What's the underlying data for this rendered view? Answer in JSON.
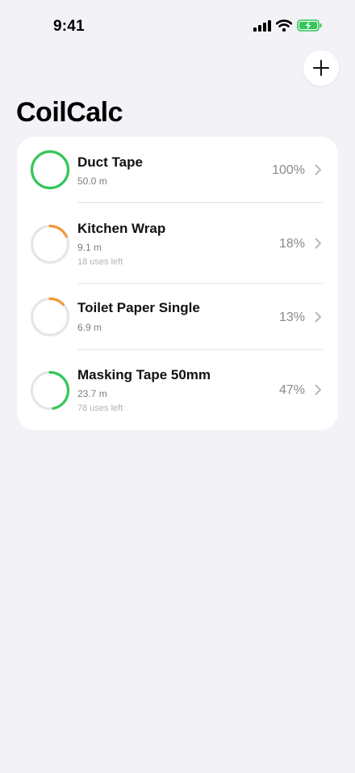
{
  "status_bar": {
    "time": "9:41"
  },
  "header": {
    "title": "CoilCalc",
    "add_icon": "plus-icon"
  },
  "colors": {
    "full": "#34c759",
    "low": "#f29a38",
    "track": "#e5e5ea"
  },
  "rolls": [
    {
      "name": "Duct Tape",
      "length": "50.0 m",
      "uses_left": "",
      "percent": "100%",
      "fraction": 1.0,
      "color": "#34c759"
    },
    {
      "name": "Kitchen Wrap",
      "length": "9.1 m",
      "uses_left": "18 uses left",
      "percent": "18%",
      "fraction": 0.18,
      "color": "#f29a38"
    },
    {
      "name": "Toilet Paper Single",
      "length": "6.9 m",
      "uses_left": "",
      "percent": "13%",
      "fraction": 0.13,
      "color": "#f29a38"
    },
    {
      "name": "Masking Tape 50mm",
      "length": "23.7 m",
      "uses_left": "78 uses left",
      "percent": "47%",
      "fraction": 0.47,
      "color": "#34c759"
    }
  ]
}
